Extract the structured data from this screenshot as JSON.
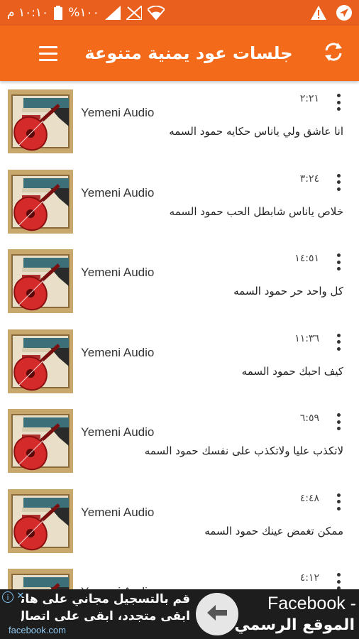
{
  "status_bar": {
    "time": "١٠:١٠ م",
    "battery": "%١٠٠",
    "icons": [
      "battery-icon",
      "signal-icon",
      "no-sim-icon",
      "wifi-icon",
      "warning-icon",
      "navigation-icon"
    ]
  },
  "app_bar": {
    "title": "جلسات عود يمنية متنوعة",
    "refresh_icon": "refresh-icon",
    "menu_icon": "menu-icon",
    "color": "#f46a1b"
  },
  "tracks": [
    {
      "source": "Yemeni Audio",
      "title": "انا عاشق ولي ياناس حكايه   حمود السمه",
      "duration": "٢:٢١"
    },
    {
      "source": "Yemeni Audio",
      "title": "خلاص ياناس شابطل الحب   حمود السمه",
      "duration": "٣:٢٤"
    },
    {
      "source": "Yemeni Audio",
      "title": "كل واحد حر   حمود السمه",
      "duration": "١٤:٥١"
    },
    {
      "source": "Yemeni Audio",
      "title": "كيف احبك    حمود السمه",
      "duration": "١١:٣٦"
    },
    {
      "source": "Yemeni Audio",
      "title": "لاتكذب عليا ولاتكذب على نفسك   حمود السمه",
      "duration": "٦:٥٩"
    },
    {
      "source": "Yemeni Audio",
      "title": "ممكن تغمض عينك    حمود السمه",
      "duration": "٤:٤٨"
    },
    {
      "source": "Yemeni Audio",
      "title": "",
      "duration": "٤:١٢"
    }
  ],
  "ad": {
    "line1": "قم بالتسجيل مجاني على هاتفك",
    "line2": "ابقى متجدد، ابقى على اتصال.",
    "domain": "facebook.com",
    "right_line1": "Facebook -",
    "right_line2": "الموقع الرسمي",
    "info_icon": "info-icon",
    "close_icon": "close-icon",
    "arrow_icon": "arrow-left-icon"
  }
}
